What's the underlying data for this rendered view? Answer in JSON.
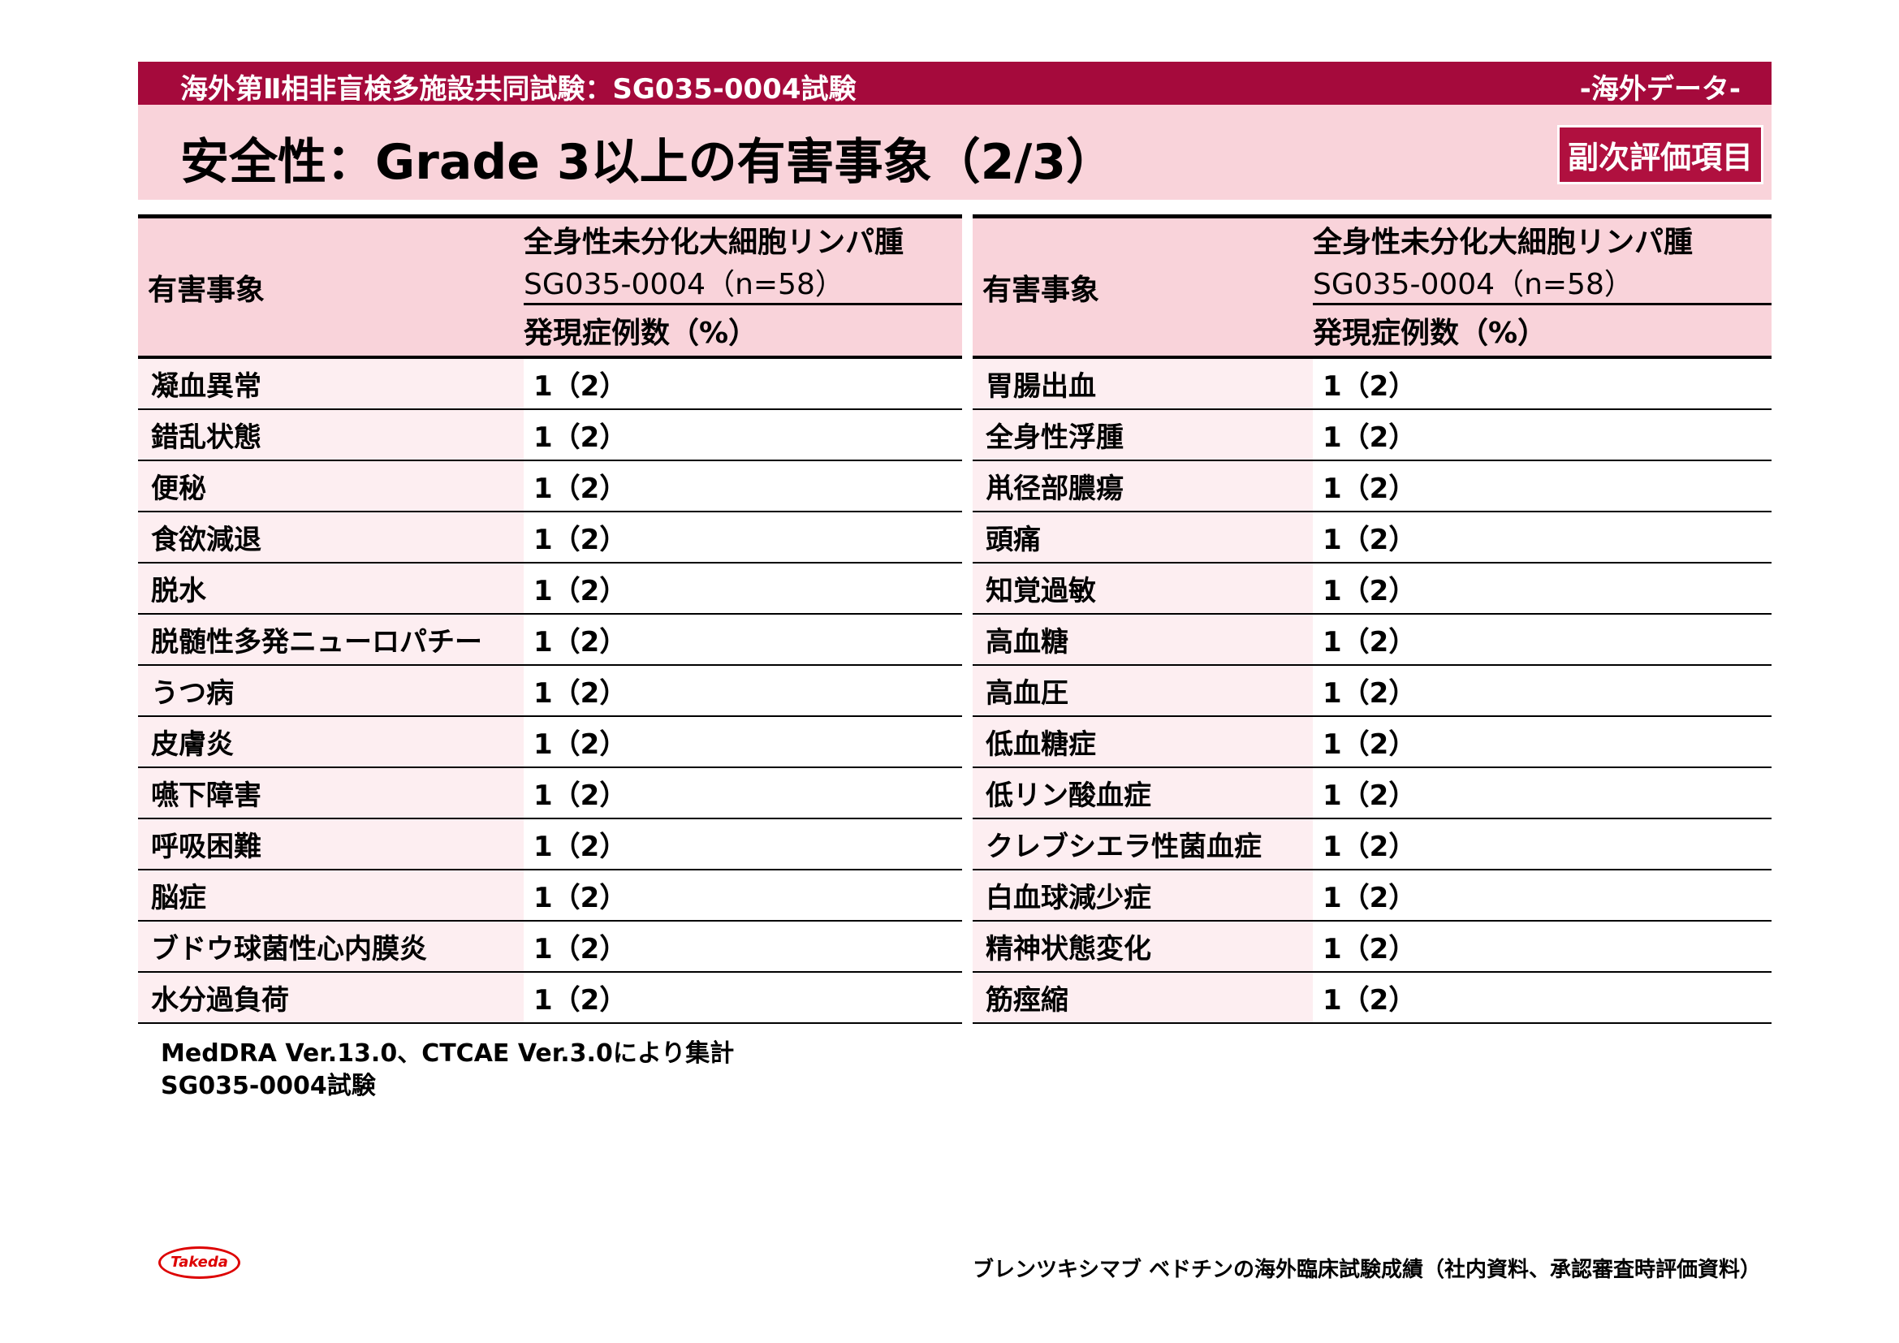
{
  "header": {
    "study": "海外第Ⅱ相非盲検多施設共同試験：SG035-0004試験",
    "tag": "-海外データ-"
  },
  "title": "安全性：Grade 3以上の有害事象（2/3）",
  "badge": "副次評価項目",
  "table_header": {
    "event": "有害事象",
    "group": "全身性未分化大細胞リンパ腫",
    "study": "SG035-0004（n=58）",
    "metric": "発現症例数（%）"
  },
  "left_rows": [
    {
      "name": "凝血異常",
      "value": "1（2）"
    },
    {
      "name": "錯乱状態",
      "value": "1（2）"
    },
    {
      "name": "便秘",
      "value": "1（2）"
    },
    {
      "name": "食欲減退",
      "value": "1（2）"
    },
    {
      "name": "脱水",
      "value": "1（2）"
    },
    {
      "name": "脱髄性多発ニューロパチー",
      "value": "1（2）"
    },
    {
      "name": "うつ病",
      "value": "1（2）"
    },
    {
      "name": "皮膚炎",
      "value": "1（2）"
    },
    {
      "name": "嚥下障害",
      "value": "1（2）"
    },
    {
      "name": "呼吸困難",
      "value": "1（2）"
    },
    {
      "name": "脳症",
      "value": "1（2）"
    },
    {
      "name": "ブドウ球菌性心内膜炎",
      "value": "1（2）"
    },
    {
      "name": "水分過負荷",
      "value": "1（2）"
    }
  ],
  "right_rows": [
    {
      "name": "胃腸出血",
      "value": "1（2）"
    },
    {
      "name": "全身性浮腫",
      "value": "1（2）"
    },
    {
      "name": "鼡径部膿瘍",
      "value": "1（2）"
    },
    {
      "name": "頭痛",
      "value": "1（2）"
    },
    {
      "name": "知覚過敏",
      "value": "1（2）"
    },
    {
      "name": "高血糖",
      "value": "1（2）"
    },
    {
      "name": "高血圧",
      "value": "1（2）"
    },
    {
      "name": "低血糖症",
      "value": "1（2）"
    },
    {
      "name": "低リン酸血症",
      "value": "1（2）"
    },
    {
      "name": "クレブシエラ性菌血症",
      "value": "1（2）"
    },
    {
      "name": "白血球減少症",
      "value": "1（2）"
    },
    {
      "name": "精神状態変化",
      "value": "1（2）"
    },
    {
      "name": "筋痙縮",
      "value": "1（2）"
    }
  ],
  "footnotes": [
    "MedDRA Ver.13.0、CTCAE Ver.3.0により集計",
    "SG035-0004試験"
  ],
  "logo": "Takeda",
  "credit": "ブレンツキシマブ ベドチンの海外臨床試験成績（社内資料、承認審査時評価資料）"
}
